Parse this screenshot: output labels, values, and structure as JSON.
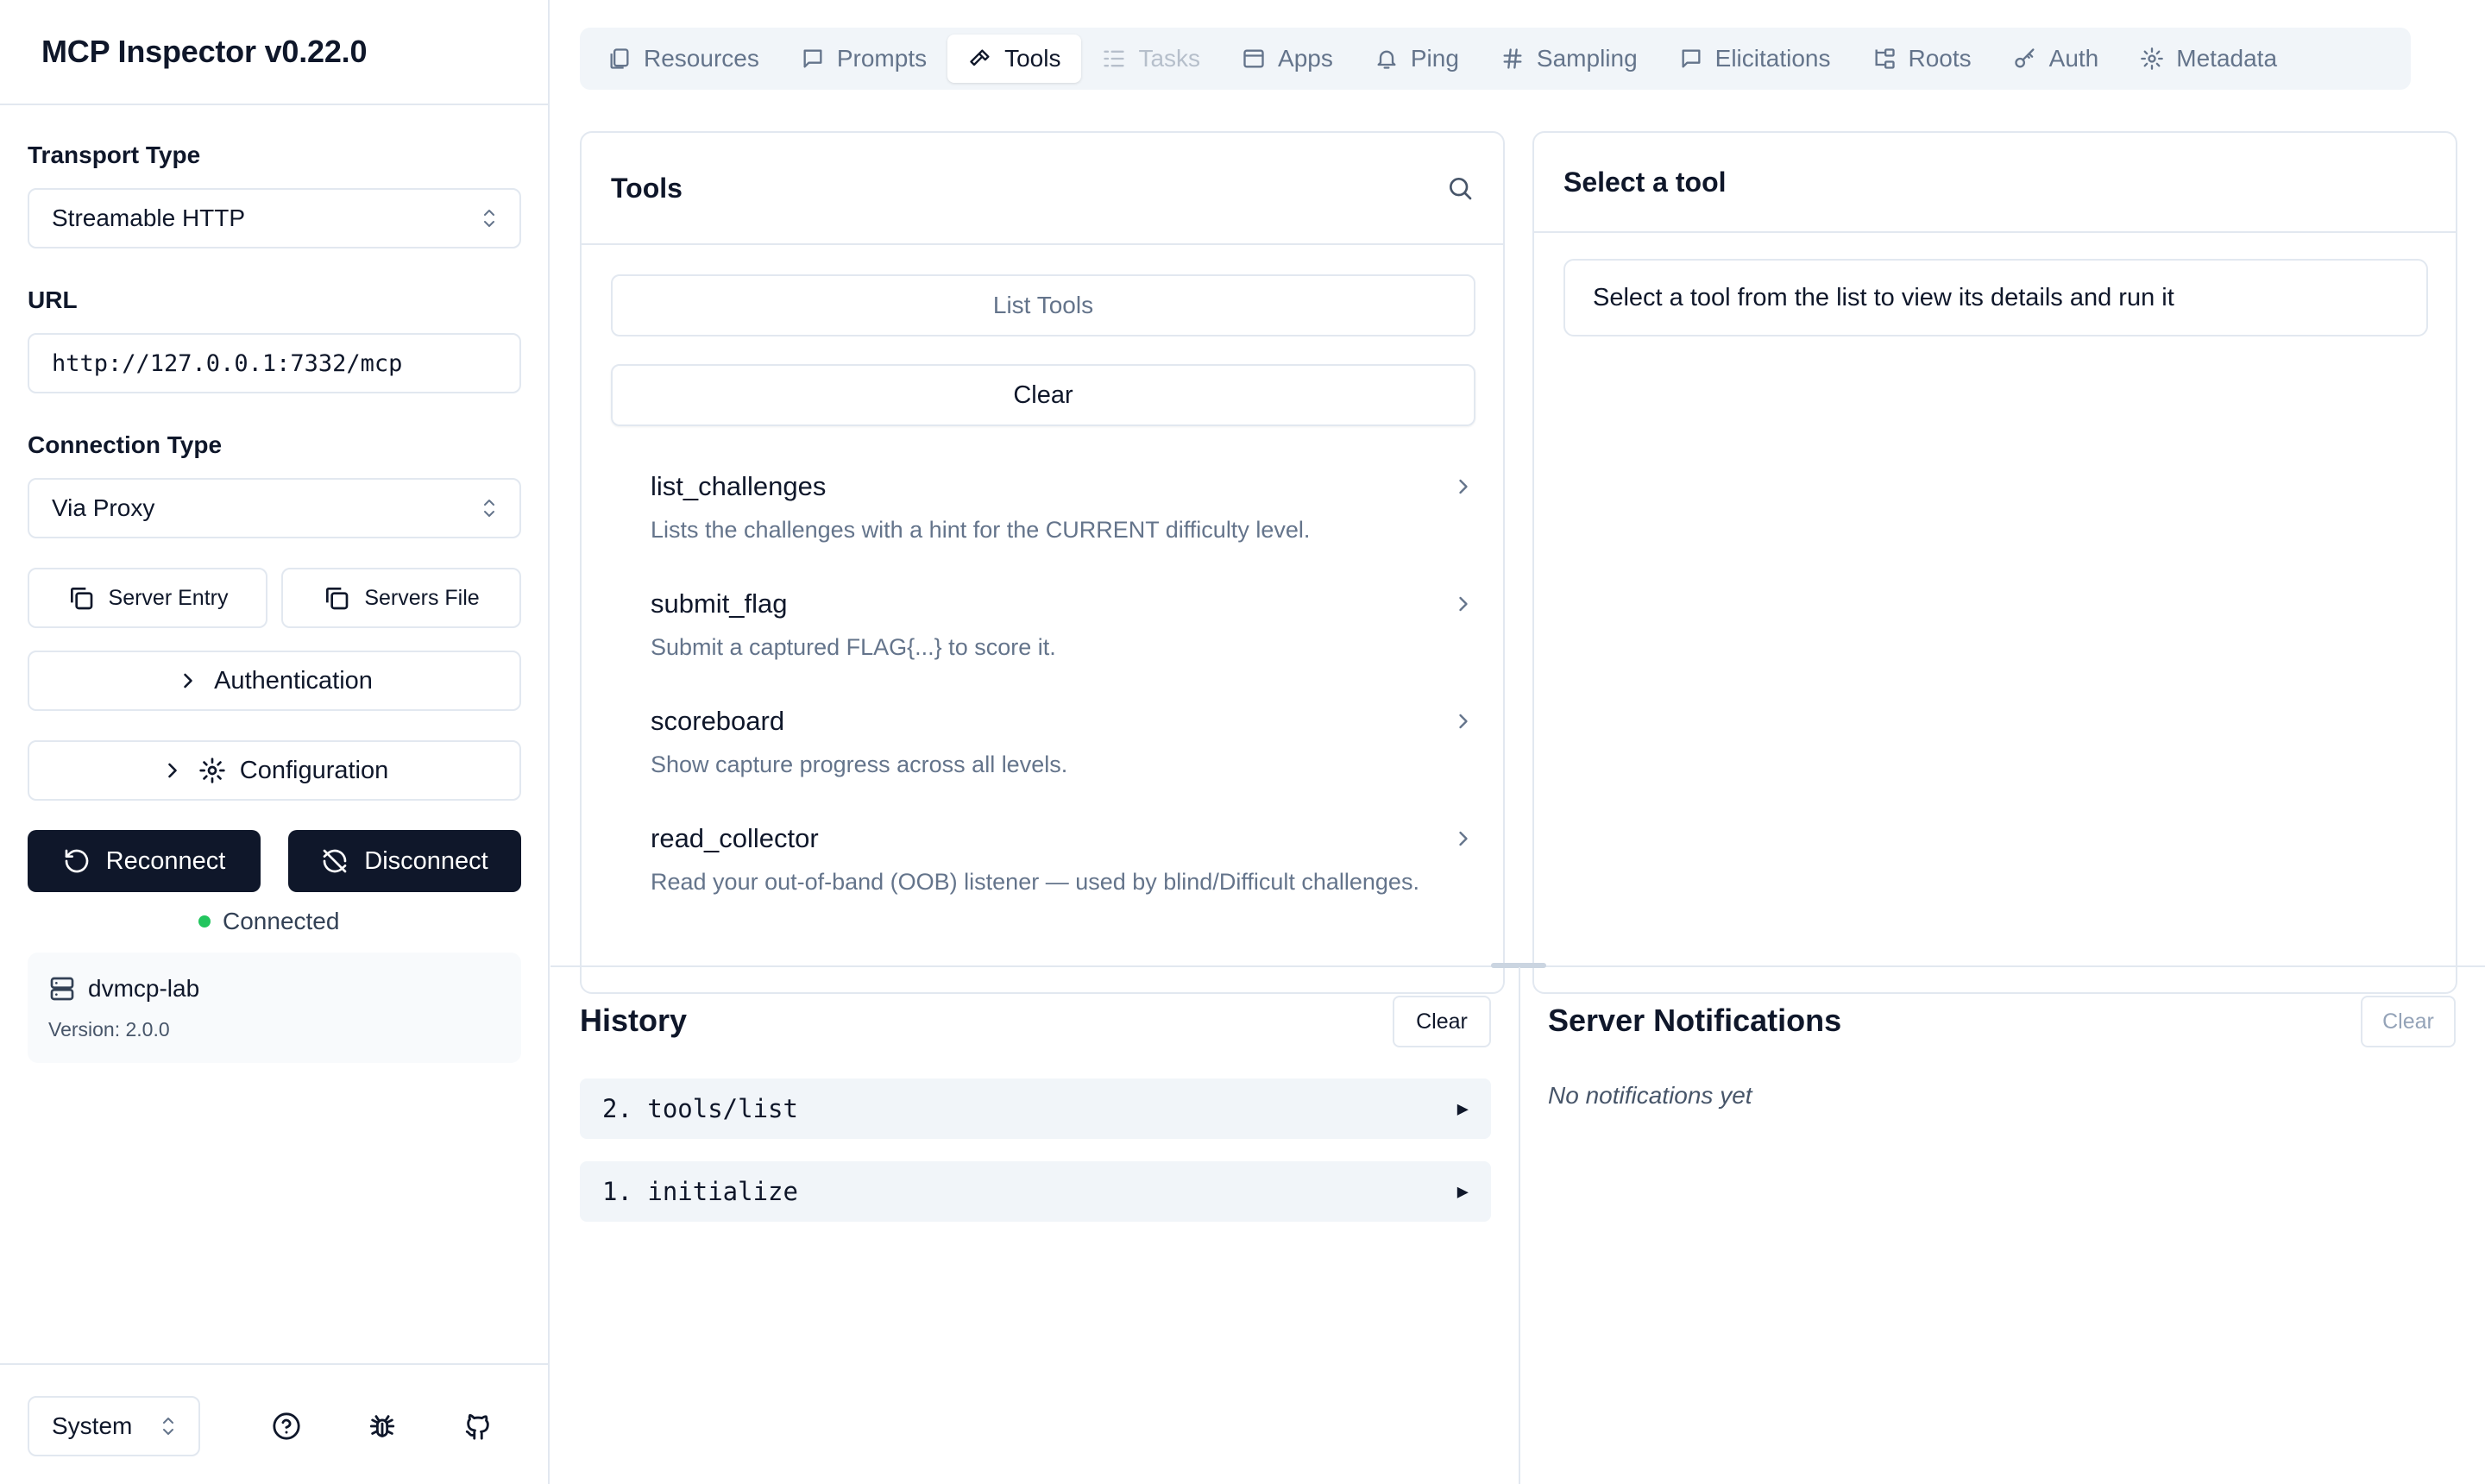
{
  "app": {
    "title": "MCP Inspector v0.22.0"
  },
  "sidebar": {
    "transport_label": "Transport Type",
    "transport_value": "Streamable HTTP",
    "url_label": "URL",
    "url_value": "http://127.0.0.1:7332/mcp",
    "connection_label": "Connection Type",
    "connection_value": "Via Proxy",
    "server_entry_label": "Server Entry",
    "servers_file_label": "Servers File",
    "authentication_label": "Authentication",
    "configuration_label": "Configuration",
    "reconnect_label": "Reconnect",
    "disconnect_label": "Disconnect",
    "status_text": "Connected",
    "status_color": "#22c55e",
    "server": {
      "name": "dvmcp-lab",
      "version": "Version: 2.0.0"
    },
    "theme_value": "System",
    "footer_icons": [
      "help-icon",
      "bug-icon",
      "github-icon"
    ]
  },
  "tabs": [
    {
      "label": "Resources",
      "icon": "resources-icon",
      "state": "normal"
    },
    {
      "label": "Prompts",
      "icon": "prompts-icon",
      "state": "normal"
    },
    {
      "label": "Tools",
      "icon": "hammer-icon",
      "state": "active"
    },
    {
      "label": "Tasks",
      "icon": "tasks-icon",
      "state": "disabled"
    },
    {
      "label": "Apps",
      "icon": "apps-icon",
      "state": "normal"
    },
    {
      "label": "Ping",
      "icon": "bell-icon",
      "state": "normal"
    },
    {
      "label": "Sampling",
      "icon": "hash-icon",
      "state": "normal"
    },
    {
      "label": "Elicitations",
      "icon": "message-icon",
      "state": "normal"
    },
    {
      "label": "Roots",
      "icon": "folder-tree-icon",
      "state": "normal"
    },
    {
      "label": "Auth",
      "icon": "key-icon",
      "state": "normal"
    },
    {
      "label": "Metadata",
      "icon": "gear-icon",
      "state": "normal"
    }
  ],
  "tools_panel": {
    "title": "Tools",
    "list_button": "List Tools",
    "clear_button": "Clear",
    "tools": [
      {
        "name": "list_challenges",
        "desc": "Lists the challenges with a hint for the CURRENT difficulty level."
      },
      {
        "name": "submit_flag",
        "desc": "Submit a captured FLAG{...} to score it."
      },
      {
        "name": "scoreboard",
        "desc": "Show capture progress across all levels."
      },
      {
        "name": "read_collector",
        "desc": "Read your out-of-band (OOB) listener — used by blind/Difficult challenges."
      }
    ]
  },
  "detail_panel": {
    "title": "Select a tool",
    "message": "Select a tool from the list to view its details and run it"
  },
  "history": {
    "title": "History",
    "clear_button": "Clear",
    "items": [
      {
        "label": "2. tools/list"
      },
      {
        "label": "1. initialize"
      }
    ]
  },
  "notifications": {
    "title": "Server Notifications",
    "clear_button": "Clear",
    "empty_text": "No notifications yet"
  }
}
